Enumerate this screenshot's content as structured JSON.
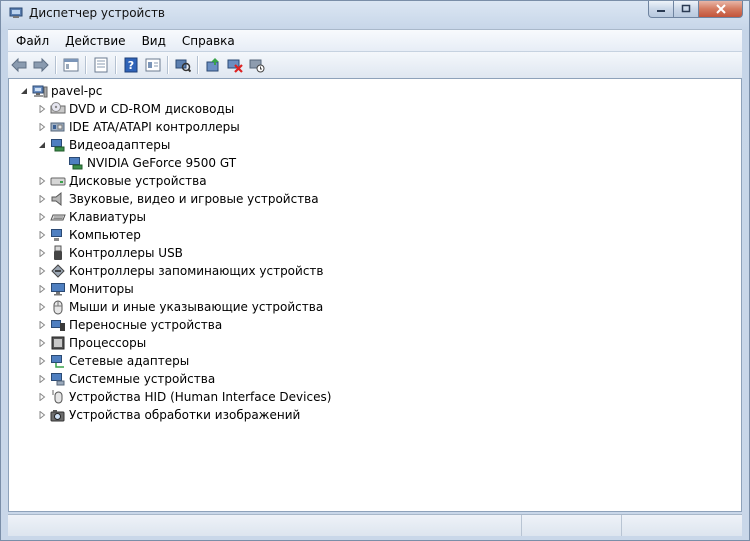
{
  "window": {
    "title": "Диспетчер устройств",
    "accent": "#c6d5e8",
    "close_color": "#c2543a"
  },
  "menu": {
    "items": [
      {
        "label": "Файл"
      },
      {
        "label": "Действие"
      },
      {
        "label": "Вид"
      },
      {
        "label": "Справка"
      }
    ]
  },
  "toolbar": {
    "buttons": [
      "back-arrow-icon",
      "forward-arrow-icon",
      "show-hide-tree-icon",
      "properties-icon",
      "help-icon",
      "properties-sheet-icon",
      "scan-hardware-icon",
      "update-driver-icon",
      "disable-device-icon",
      "uninstall-device-icon"
    ]
  },
  "tree": {
    "root": {
      "label": "pavel-pc",
      "icon": "computer-icon",
      "expanded": true
    },
    "items": [
      {
        "label": "DVD и CD-ROM дисководы",
        "icon": "dvd-drive-icon",
        "expanded": false
      },
      {
        "label": "IDE ATA/ATAPI контроллеры",
        "icon": "ide-controller-icon",
        "expanded": false
      },
      {
        "label": "Видеоадаптеры",
        "icon": "display-adapter-icon",
        "expanded": true,
        "children": [
          {
            "label": "NVIDIA GeForce 9500 GT",
            "icon": "display-adapter-icon"
          }
        ]
      },
      {
        "label": "Дисковые устройства",
        "icon": "disk-drive-icon",
        "expanded": false
      },
      {
        "label": "Звуковые, видео и игровые устройства",
        "icon": "speaker-icon",
        "expanded": false
      },
      {
        "label": "Клавиатуры",
        "icon": "keyboard-icon",
        "expanded": false
      },
      {
        "label": "Компьютер",
        "icon": "computer-icon",
        "expanded": false
      },
      {
        "label": "Контроллеры USB",
        "icon": "usb-icon",
        "expanded": false
      },
      {
        "label": "Контроллеры запоминающих устройств",
        "icon": "storage-controller-icon",
        "expanded": false
      },
      {
        "label": "Мониторы",
        "icon": "monitor-icon",
        "expanded": false
      },
      {
        "label": "Мыши и иные указывающие устройства",
        "icon": "mouse-icon",
        "expanded": false
      },
      {
        "label": "Переносные устройства",
        "icon": "portable-device-icon",
        "expanded": false
      },
      {
        "label": "Процессоры",
        "icon": "processor-icon",
        "expanded": false
      },
      {
        "label": "Сетевые адаптеры",
        "icon": "network-adapter-icon",
        "expanded": false
      },
      {
        "label": "Системные устройства",
        "icon": "system-device-icon",
        "expanded": false
      },
      {
        "label": "Устройства HID (Human Interface Devices)",
        "icon": "hid-icon",
        "expanded": false
      },
      {
        "label": "Устройства обработки изображений",
        "icon": "camera-icon",
        "expanded": false
      }
    ]
  }
}
